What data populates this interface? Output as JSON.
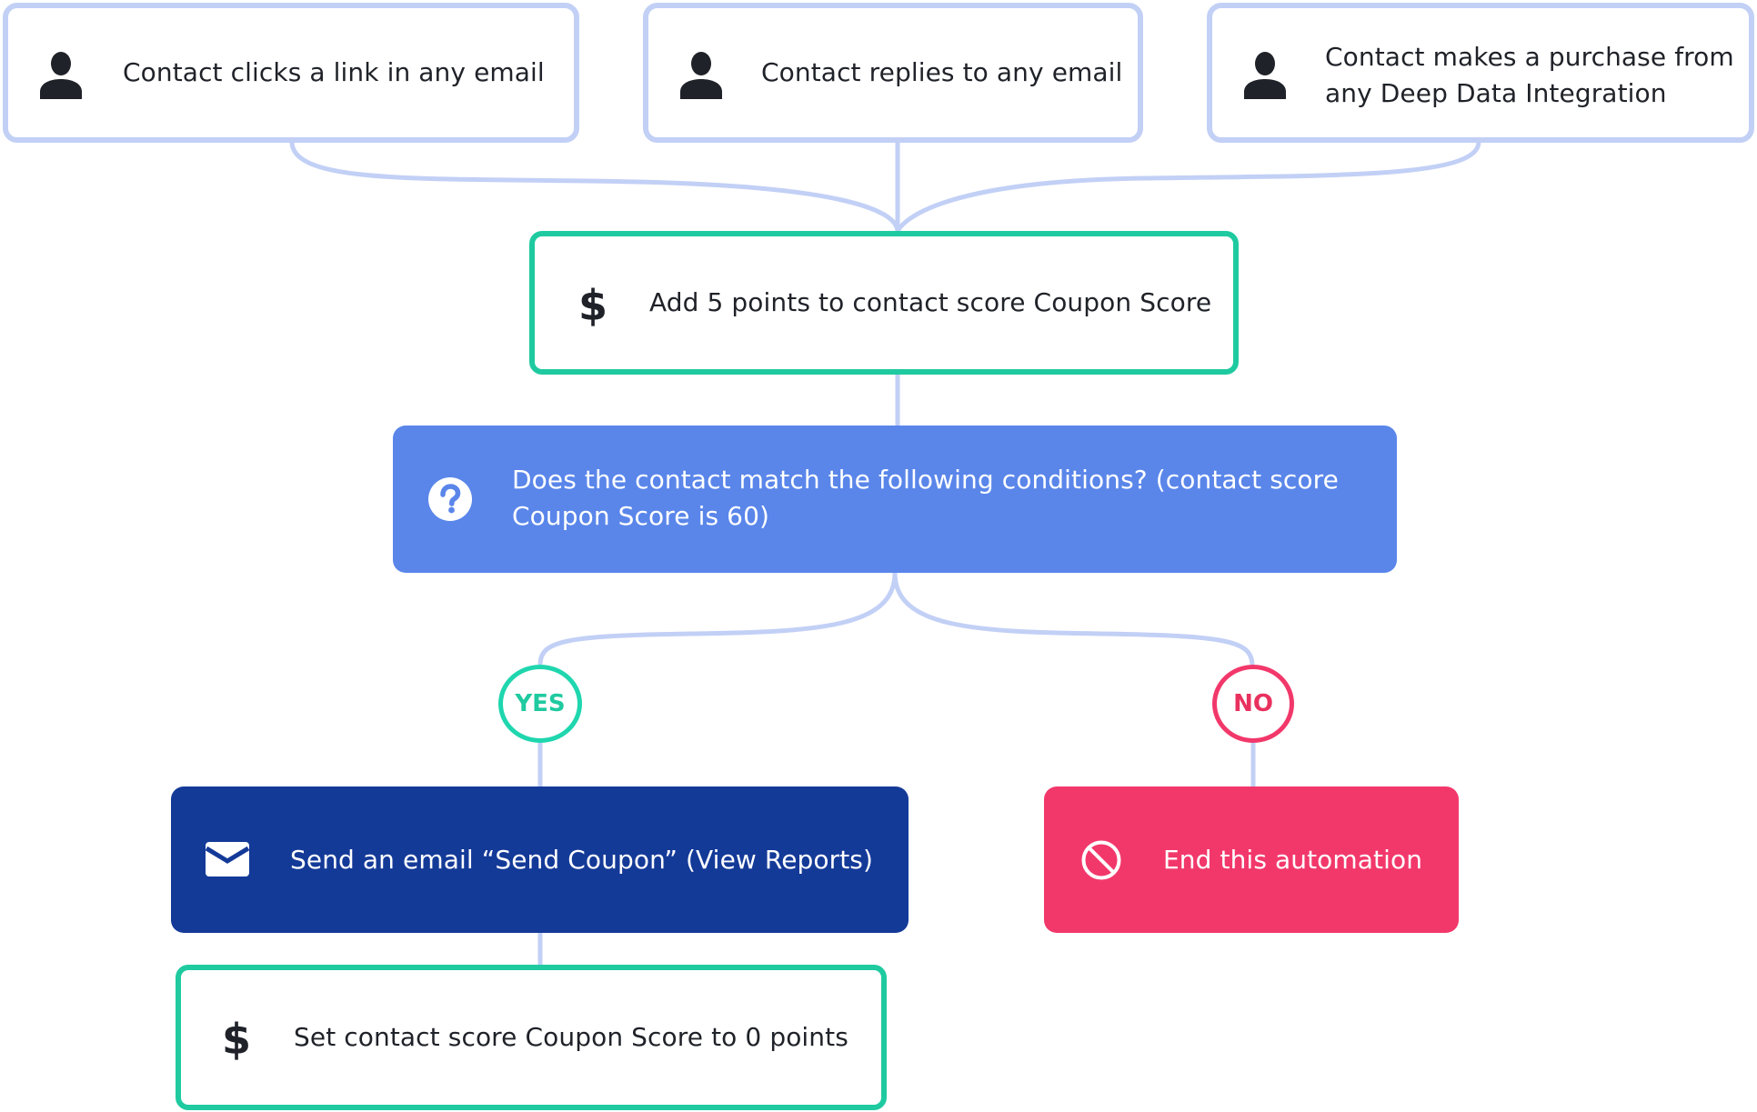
{
  "colors": {
    "connector": "#c2d0f6",
    "trigger_border": "#c2d0f6",
    "action_border": "#1fcaa0",
    "condition_bg": "#5a86ea",
    "email_bg": "#143a98",
    "end_bg": "#f2386b",
    "yes": "#1fcaa0",
    "no": "#f2386b",
    "text_dark": "#1f2228"
  },
  "triggers": [
    {
      "icon": "person-icon",
      "label": "Contact clicks a link in any email"
    },
    {
      "icon": "person-icon",
      "label": "Contact replies to any email"
    },
    {
      "icon": "person-icon",
      "label_line1": "Contact makes a purchase from",
      "label_line2": "any Deep Data Integration"
    }
  ],
  "add_points": {
    "icon": "dollar-icon",
    "symbol": "$",
    "label": "Add 5 points to contact score Coupon Score"
  },
  "condition": {
    "icon": "question-icon",
    "label_line1": "Does the contact match the following conditions? (contact score",
    "label_line2": "Coupon Score is 60)"
  },
  "branches": {
    "yes": "YES",
    "no": "NO"
  },
  "send_email": {
    "icon": "envelope-icon",
    "label": "Send an email “Send Coupon” (View Reports)"
  },
  "end": {
    "icon": "prohibited-icon",
    "label": "End this automation"
  },
  "set_score": {
    "icon": "dollar-icon",
    "symbol": "$",
    "label": "Set contact score Coupon Score to 0 points"
  }
}
